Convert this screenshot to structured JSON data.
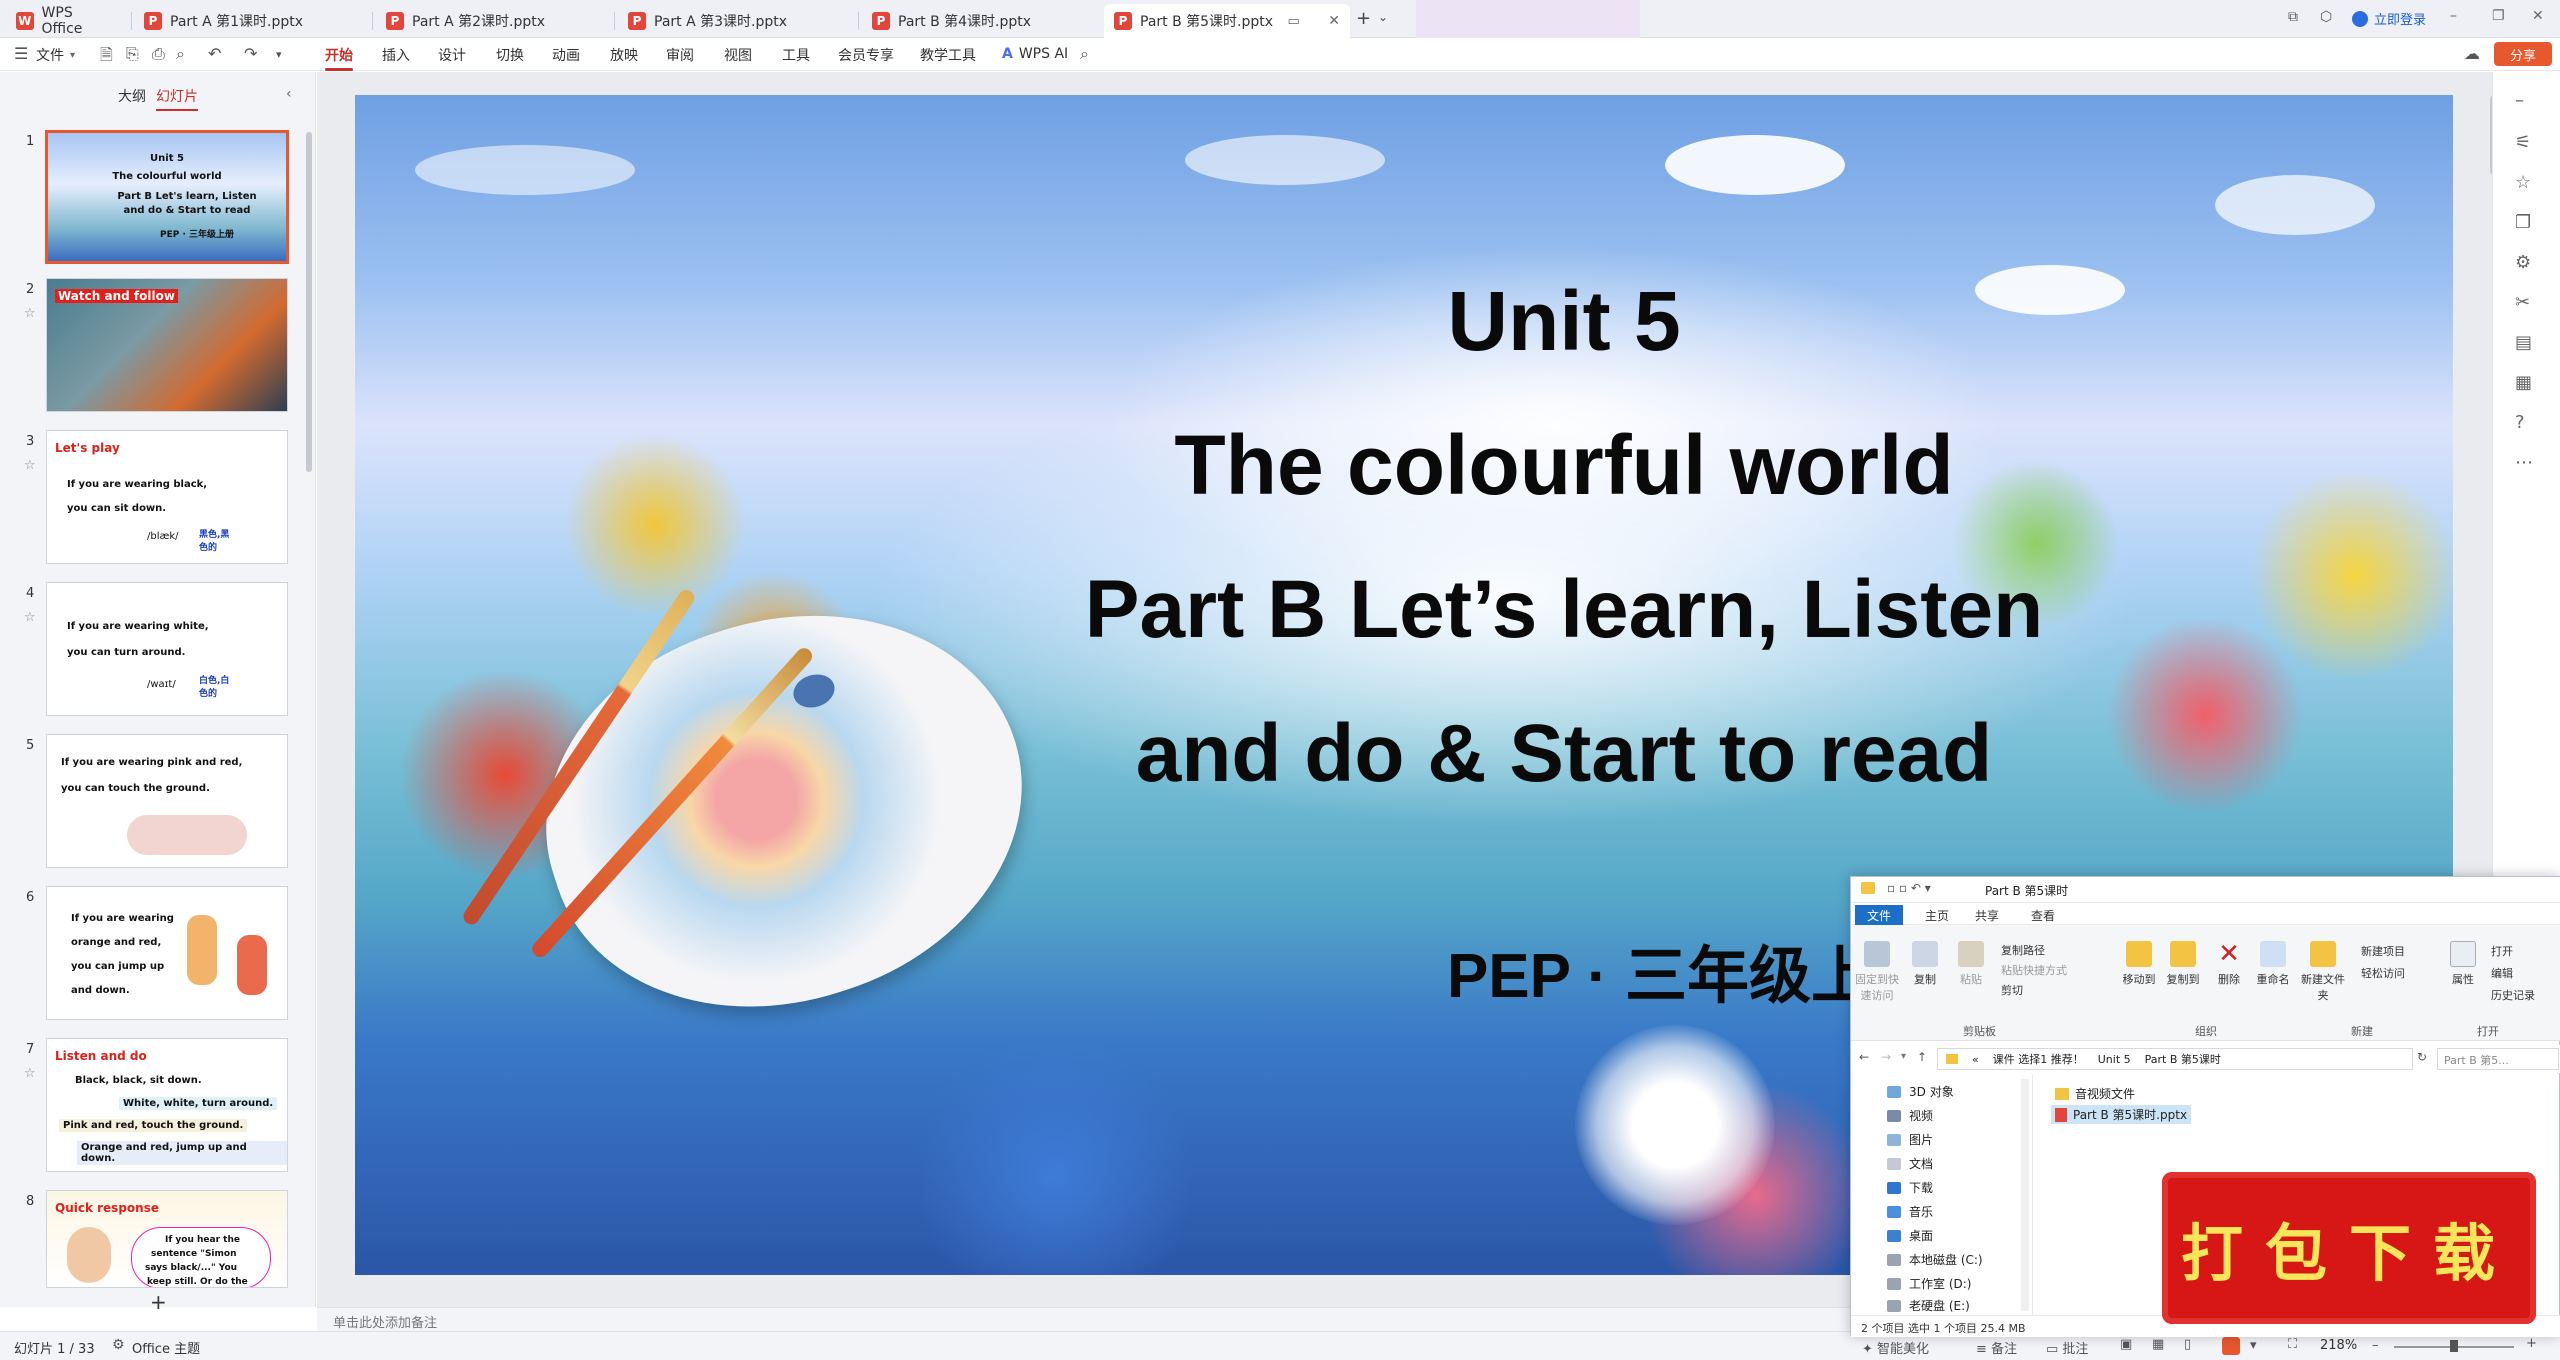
{
  "tabs": [
    {
      "label": "WPS Office"
    },
    {
      "label": "Part A 第1课时.pptx"
    },
    {
      "label": "Part A 第2课时.pptx"
    },
    {
      "label": "Part A 第3课时.pptx"
    },
    {
      "label": "Part B 第4课时.pptx"
    },
    {
      "label": "Part B 第5课时.pptx"
    }
  ],
  "topbar": {
    "login": "立即登录",
    "share": "分享"
  },
  "menu": {
    "file": "文件",
    "items": [
      "开始",
      "插入",
      "设计",
      "切换",
      "动画",
      "放映",
      "审阅",
      "视图",
      "工具",
      "会员专享",
      "教学工具"
    ],
    "wps_ai": "WPS AI"
  },
  "left_panel": {
    "tabs": [
      "大纲",
      "幻灯片"
    ],
    "slides": [
      {
        "num": "1",
        "lines": [
          "Unit 5",
          "The colourful world",
          "Part B Let's learn, Listen",
          "and do & Start to read",
          "PEP · 三年级上册"
        ]
      },
      {
        "num": "2",
        "head": "Watch and follow"
      },
      {
        "num": "3",
        "head": "Let's play",
        "lines": [
          "If you are wearing black,",
          "you can sit down.",
          "/blæk/",
          "黑色,黑色的"
        ]
      },
      {
        "num": "4",
        "lines": [
          "If you are wearing white,",
          "you can turn around.",
          "/waɪt/",
          "白色,白色的"
        ]
      },
      {
        "num": "5",
        "lines": [
          "If you are wearing pink and red,",
          "you can touch the ground."
        ]
      },
      {
        "num": "6",
        "lines": [
          "If you are wearing",
          "orange and red,",
          "you can jump up",
          "and down."
        ]
      },
      {
        "num": "7",
        "head": "Listen and do",
        "lines": [
          "Black, black, sit down.",
          "White, white, turn around.",
          "Pink and red, touch the ground.",
          "Orange and red, jump up and down."
        ]
      },
      {
        "num": "8",
        "head": "Quick response",
        "lines": [
          "If you hear the",
          "sentence \"Simon",
          "says black/...\" You",
          "keep still. Or do the"
        ]
      }
    ],
    "add_label": "+"
  },
  "slide": {
    "line1": "Unit 5",
    "line2": "The colourful world",
    "line3": "Part B Let’s learn, Listen",
    "line4": "and do & Start to read",
    "line5": "PEP · 三年级上册"
  },
  "notes_placeholder": "单击此处添加备注",
  "status": {
    "slide_counter": "幻灯片 1 / 33",
    "theme": "Office 主题",
    "beautify": "智能美化",
    "notes": "备注",
    "comments": "批注",
    "zoom": "218%"
  },
  "explorer": {
    "title": "Part B 第5课时",
    "ribbon_tabs": [
      "文件",
      "主页",
      "共享",
      "查看"
    ],
    "ribbon_items": [
      "固定到快速访问",
      "复制",
      "粘贴",
      "移动到",
      "复制到",
      "删除",
      "重命名",
      "新建文件夹",
      "属性"
    ],
    "small_items": [
      "复制路径",
      "粘贴快捷方式",
      "剪切",
      "新建项目",
      "轻松访问",
      "打开",
      "编辑",
      "历史记录"
    ],
    "groups": [
      "剪贴板",
      "组织",
      "新建",
      "打开"
    ],
    "path": [
      "«",
      "课件 选择1 推荐！",
      "Unit 5",
      "Part B 第5课时"
    ],
    "search": "Part B 第5...",
    "tree": [
      "3D 对象",
      "视频",
      "图片",
      "文档",
      "下载",
      "音乐",
      "桌面",
      "本地磁盘 (C:)",
      "工作室 (D:)",
      "老硬盘 (E:)"
    ],
    "files": [
      "音视频文件",
      "Part B 第5课时.pptx"
    ],
    "status": "2 个项目    选中 1 个项目  25.4 MB"
  },
  "stamp": "打包下载",
  "colors": {
    "accent": "#c9302c",
    "selected_border": "#e8582e",
    "share": "#e8582e",
    "stamp": "#d71616"
  }
}
